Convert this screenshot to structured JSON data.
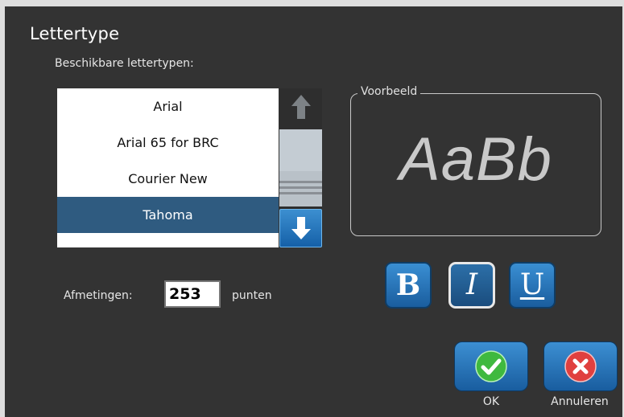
{
  "dialog": {
    "title": "Lettertype",
    "subtitle": "Beschikbare lettertypen:"
  },
  "font_list": {
    "items": [
      "Arial",
      "Arial 65 for BRC",
      "Courier New",
      "Tahoma"
    ],
    "selected": "Tahoma"
  },
  "preview": {
    "legend": "Voorbeeld",
    "sample": "AaBb"
  },
  "style_buttons": {
    "bold": "B",
    "italic": "I",
    "underline": "U",
    "italic_active": true
  },
  "size": {
    "label": "Afmetingen:",
    "value": "253",
    "unit": "punten"
  },
  "actions": {
    "ok": "OK",
    "cancel": "Annuleren"
  },
  "colors": {
    "background": "#333333",
    "selection": "#2f5b80",
    "button_blue": "#2a78bd",
    "ok_green": "#3fb93f",
    "cancel_red": "#e0403f"
  },
  "icons": [
    "arrow-up-icon",
    "arrow-down-icon",
    "checkmark-icon",
    "x-icon"
  ]
}
